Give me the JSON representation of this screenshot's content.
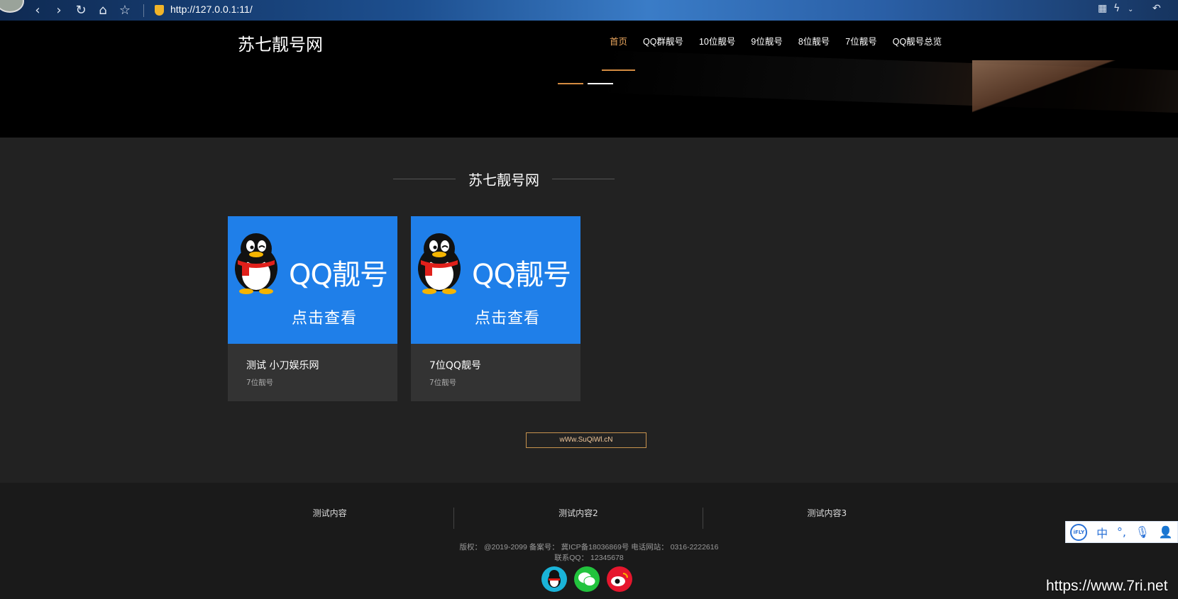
{
  "browser": {
    "url": "http://127.0.0.1:11/",
    "url_display": "http://127.0.0.1:11/"
  },
  "header": {
    "logo": "苏七靓号网",
    "nav": [
      "首页",
      "QQ群靓号",
      "10位靓号",
      "9位靓号",
      "8位靓号",
      "7位靓号",
      "QQ靓号总览"
    ],
    "active_nav": 0
  },
  "main": {
    "section_title": "苏七靓号网",
    "cards": [
      {
        "image_title": "QQ靓号",
        "image_sub": "点击查看",
        "title": "测试 小刀娱乐网",
        "category": "7位靓号"
      },
      {
        "image_title": "QQ靓号",
        "image_sub": "点击查看",
        "title": "7位QQ靓号",
        "category": "7位靓号"
      }
    ],
    "site_button": "wWw.SuQiWl.cN"
  },
  "footer": {
    "columns": [
      "测试内容",
      "测试内容2",
      "测试内容3"
    ],
    "copyright_line1": "版权： @2019-2099 备案号： 冀ICP备18036869号 电话网站： 0316-2222616",
    "copyright_line2": "联系QQ： 12345678"
  },
  "ime": {
    "logo": "iFLY",
    "mode": "中"
  },
  "watermark": "https://www.7ri.net",
  "colors": {
    "accent": "#d38b41",
    "card_image_bg": "#1f7fe9",
    "page_bg": "#222222"
  }
}
